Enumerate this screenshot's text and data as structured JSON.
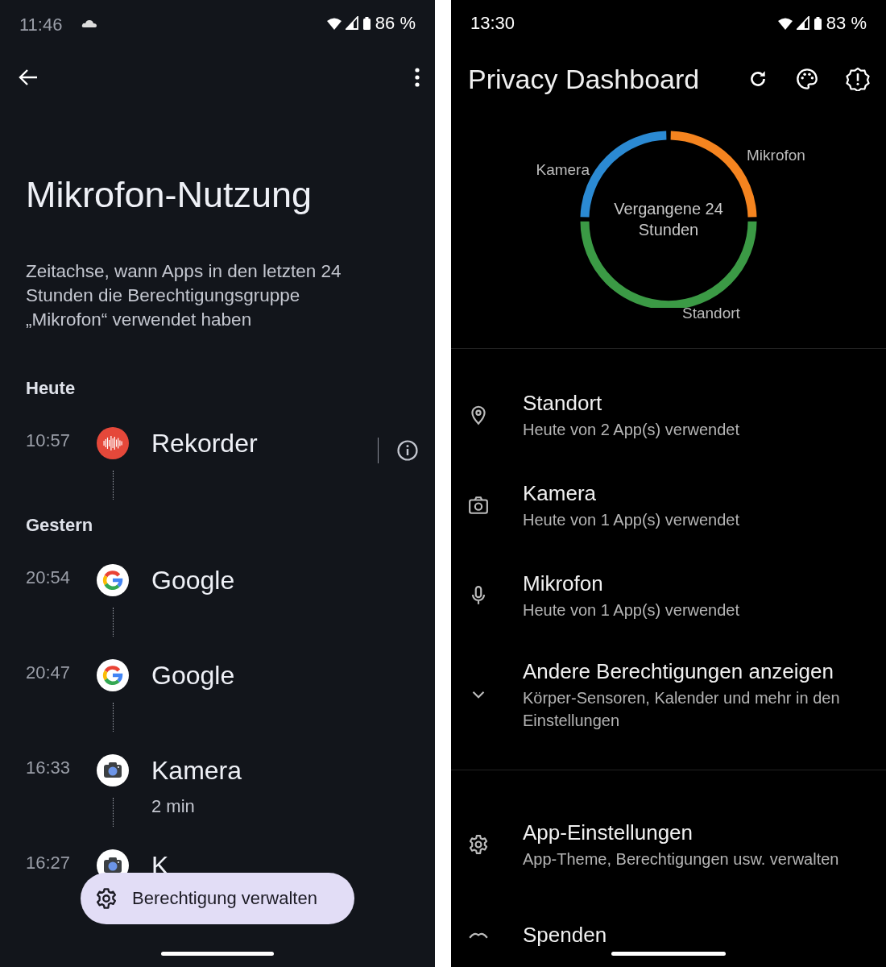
{
  "left": {
    "status_bar": {
      "time": "11:46",
      "battery": "86 %"
    },
    "title": "Mikrofon-Nutzung",
    "description": "Zeitachse, wann Apps in den letzten 24 Stunden die Berechtigungsgruppe „Mikrofon“ verwendet haben",
    "sections": [
      {
        "heading": "Heute",
        "entries": [
          {
            "time": "10:57",
            "app": "Rekorder",
            "kind": "recorder",
            "info": true
          }
        ]
      },
      {
        "heading": "Gestern",
        "entries": [
          {
            "time": "20:54",
            "app": "Google",
            "kind": "google"
          },
          {
            "time": "20:47",
            "app": "Google",
            "kind": "google"
          },
          {
            "time": "16:33",
            "app": "Kamera",
            "kind": "camera",
            "duration": "2 min"
          },
          {
            "time": "16:27",
            "app": "K",
            "kind": "camera"
          }
        ]
      }
    ],
    "fab": {
      "label": "Berechtigung verwalten"
    }
  },
  "right": {
    "status_bar": {
      "time": "13:30",
      "battery": "83 %"
    },
    "title": "Privacy Dashboard",
    "usage_ring": {
      "center": "Vergangene 24 Stunden",
      "segments": [
        {
          "label": "Kamera",
          "color": "#2b8ad3"
        },
        {
          "label": "Mikrofon",
          "color": "#f5841f"
        },
        {
          "label": "Standort",
          "color": "#3b9a45"
        }
      ]
    },
    "permissions": [
      {
        "kind": "location",
        "title": "Standort",
        "subtitle": "Heute von 2 App(s) verwendet"
      },
      {
        "kind": "camera",
        "title": "Kamera",
        "subtitle": "Heute von 1 App(s) verwendet"
      },
      {
        "kind": "microphone",
        "title": "Mikrofon",
        "subtitle": "Heute von 1 App(s) verwendet"
      },
      {
        "kind": "expand",
        "title": "Andere Berechtigungen anzeigen",
        "subtitle": "Körper-Sensoren, Kalender und mehr in den Einstellungen"
      }
    ],
    "settings": [
      {
        "kind": "settings",
        "title": "App-Einstellungen",
        "subtitle": "App-Theme, Berechtigungen usw. verwalten"
      },
      {
        "kind": "donate",
        "title": "Spenden"
      }
    ]
  }
}
